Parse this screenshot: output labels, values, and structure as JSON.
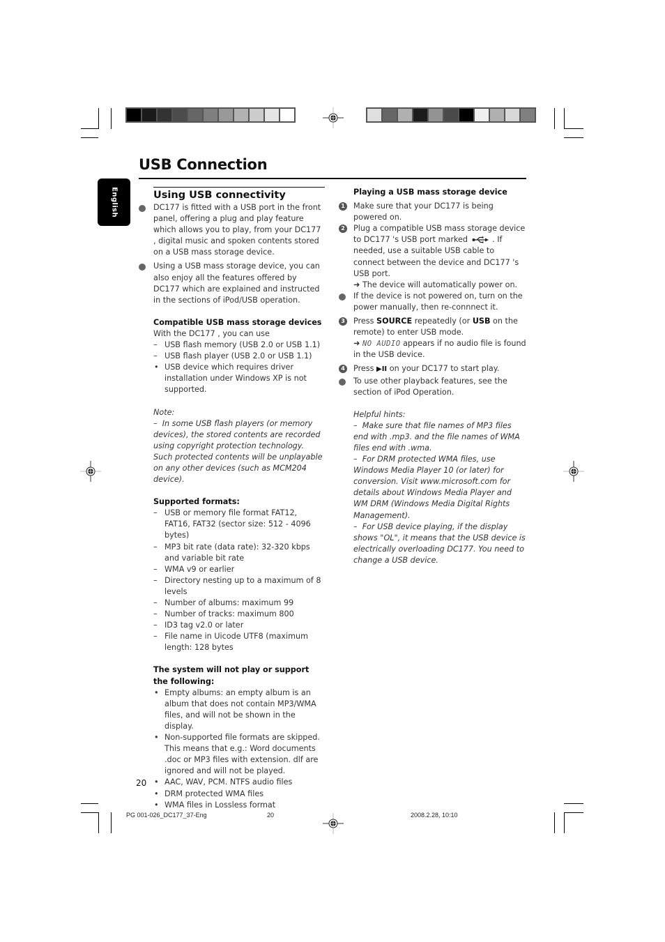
{
  "print_marks": {
    "left_colorbar": [
      "#000000",
      "#1a1a1a",
      "#333333",
      "#4c4c4c",
      "#666666",
      "#7f7f7f",
      "#999999",
      "#b2b2b2",
      "#cccccc",
      "#e5e5e5",
      "#ffffff"
    ],
    "right_colorbar": [
      "#e0e0e0",
      "#666666",
      "#b0b0b0",
      "#1c1c1c",
      "#939393",
      "#4a4a4a",
      "#000000",
      "#f0f0f0",
      "#b0b0b0",
      "#d8d8d8",
      "#808080"
    ]
  },
  "language_tab": "English",
  "page_title": "USB Connection",
  "left": {
    "section_title": "Using USB connectivity",
    "intro_bullets": [
      "DC177 is fitted with a USB port in the front panel, offering a plug and play feature which allows you to play, from your DC177 , digital music and spoken contents stored on a USB mass storage device.",
      "Using a USB mass storage device, you can also enjoy all the features offered by DC177 which are explained and instructed in the sections of iPod/USB operation."
    ],
    "compatible": {
      "heading": "Compatible USB mass storage devices",
      "lead": "With the DC177 , you can use",
      "dash_items": [
        "USB flash memory (USB 2.0 or USB 1.1)",
        "USB flash player (USB 2.0 or USB 1.1)"
      ],
      "point_items": [
        "USB device which requires driver installation under Windows XP is not supported."
      ]
    },
    "note": {
      "label": "Note:",
      "text": "In some USB flash players (or memory devices), the stored contents are recorded using copyright protection technology. Such protected contents will be unplayable on any other devices (such as MCM204 device)."
    },
    "formats": {
      "heading": "Supported formats:",
      "items": [
        "USB or memory file format FAT12, FAT16, FAT32 (sector size: 512 - 4096 bytes)",
        "MP3 bit rate (data rate): 32-320 kbps and variable bit rate",
        "WMA v9 or earlier",
        "Directory nesting up to a maximum of 8 levels",
        "Number of albums: maximum 99",
        "Number of tracks: maximum 800",
        "ID3 tag v2.0 or later",
        "File name in Uicode UTF8 (maximum length: 128 bytes"
      ]
    },
    "unsupported": {
      "heading": "The system will not play or support the following:",
      "items": [
        "Empty albums: an empty album is an album that does not contain MP3/WMA files, and will not be shown in the display.",
        "Non-supported file formats are skipped. This means that e.g.: Word documents .doc or MP3 files with extension. dlf are ignored and will not be played.",
        "AAC, WAV, PCM. NTFS audio files",
        "DRM protected WMA files",
        "WMA files in Lossless format"
      ]
    }
  },
  "right": {
    "heading": "Playing a USB mass storage device",
    "step1": {
      "num": "1",
      "text": "Make sure that your DC177 is being powered on."
    },
    "step2": {
      "num": "2",
      "text_before_icon": "Plug a compatible USB mass storage device to DC177 's USB port marked",
      "text_after_icon": ". If needed, use a suitable USB cable to connect between the device and DC177 's USB port.",
      "result": "The device will automatically power on."
    },
    "bullet_power": "If the device is not powered on, turn on the power manually, then re-connnect it.",
    "step3": {
      "num": "3",
      "press": "Press",
      "key1": "SOURCE",
      "mid": "repeatedly (or",
      "key2": "USB",
      "end": "on the remote) to enter USB mode.",
      "lcd": "NO AUDIO",
      "result_tail": "appears if no audio file is found in the USB device."
    },
    "step4": {
      "num": "4",
      "press": "Press",
      "key": "▶II",
      "end": "on your DC177 to start play."
    },
    "bullet_other": "To use other playback features, see the section of iPod Operation.",
    "hints": {
      "label": "Helpful hints:",
      "items": [
        "Make sure that file names of MP3 files end with .mp3. and the file names of WMA files end with .wma.",
        "For DRM protected WMA files, use Windows Media Player 10 (or later) for conversion. Visit www.microsoft.com for details about Windows Media Player and WM DRM (Windows Media Digital Rights Management).",
        "For USB device playing, if the display shows \"OL\", it means that the USB device is electrically overloading DC177. You need to change a USB device."
      ]
    }
  },
  "page_number": "20",
  "footer": {
    "file": "PG 001-026_DC177_37-Eng",
    "page": "20",
    "datetime": "2008.2.28, 10:10"
  }
}
